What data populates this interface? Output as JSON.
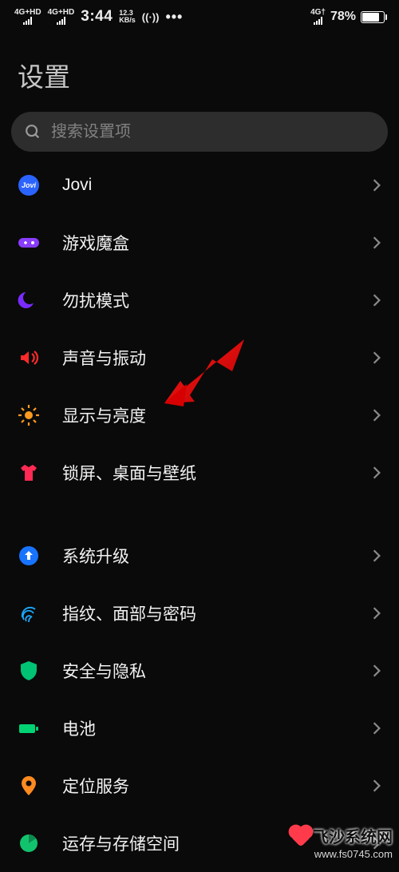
{
  "status": {
    "net_label": "4G+HD",
    "time": "3:44",
    "rate_top": "12.3",
    "rate_bottom": "KB/s",
    "radio": "((·))",
    "more": "•••",
    "net_right": "4G†",
    "battery_pct": "78%"
  },
  "page": {
    "title": "设置"
  },
  "search": {
    "placeholder": "搜索设置项"
  },
  "menu": {
    "jovi": "Jovi",
    "game_box": "游戏魔盒",
    "dnd": "勿扰模式",
    "sound": "声音与振动",
    "display": "显示与亮度",
    "lock_wall": "锁屏、桌面与壁纸",
    "system_update": "系统升级",
    "biometrics": "指纹、面部与密码",
    "security": "安全与隐私",
    "battery": "电池",
    "location": "定位服务",
    "storage": "运存与存储空间"
  },
  "icon_colors": {
    "jovi": "#2b63ff",
    "game_box": "#8a3cff",
    "dnd": "#7a2bff",
    "sound": "#ff2a2a",
    "display": "#ff9a1f",
    "lock_wall": "#ff2a54",
    "system_update": "#1873ff",
    "biometrics": "#1aa9ff",
    "security": "#00c374",
    "battery": "#00d374",
    "location": "#ff8a1f",
    "storage": "#12c36e"
  },
  "watermark": {
    "brand": "飞沙系统网",
    "url": "www.fs0745.com"
  }
}
